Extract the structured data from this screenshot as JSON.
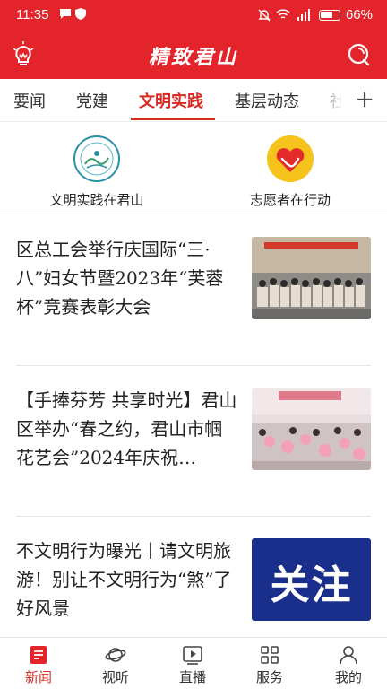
{
  "status_bar": {
    "time": "11:35",
    "battery": "66%"
  },
  "header": {
    "app_title": "精致君山",
    "bulb_icon": "bulb-icon",
    "search_icon": "search-icon",
    "brand_color": "#e4242b"
  },
  "tabs": [
    {
      "label": "要闻",
      "active": false
    },
    {
      "label": "党建",
      "active": false
    },
    {
      "label": "文明实践",
      "active": true
    },
    {
      "label": "基层动态",
      "active": false
    },
    {
      "label": "社",
      "active": false
    }
  ],
  "tabs_add_label": "+",
  "shortcuts": [
    {
      "label": "文明实践在君山",
      "icon": "civilization-practice-logo-icon"
    },
    {
      "label": "志愿者在行动",
      "icon": "volunteer-heart-icon"
    }
  ],
  "news": [
    {
      "title": "区总工会举行庆国际“三·八”妇女节暨2023年“芙蓉杯”竞赛表彰大会",
      "thumb": "group-photo-banner"
    },
    {
      "title": "【手捧芬芳 共享时光】君山区举办“春之约，君山市帼花艺会”2024年庆祝…",
      "thumb": "flower-arranging-event"
    },
    {
      "title": "不文明行为曝光丨请文明旅游！别让不文明行为“煞”了好风景",
      "thumb": "follow-badge",
      "thumb_text": "关注"
    }
  ],
  "bottom_nav": [
    {
      "label": "新闻",
      "icon": "news-icon",
      "active": true
    },
    {
      "label": "视听",
      "icon": "planet-icon",
      "active": false
    },
    {
      "label": "直播",
      "icon": "live-play-icon",
      "active": false
    },
    {
      "label": "服务",
      "icon": "grid-services-icon",
      "active": false
    },
    {
      "label": "我的",
      "icon": "profile-icon",
      "active": false
    }
  ],
  "colors": {
    "accent": "#d62a23",
    "thumb3_bg": "#1a2e8c"
  }
}
